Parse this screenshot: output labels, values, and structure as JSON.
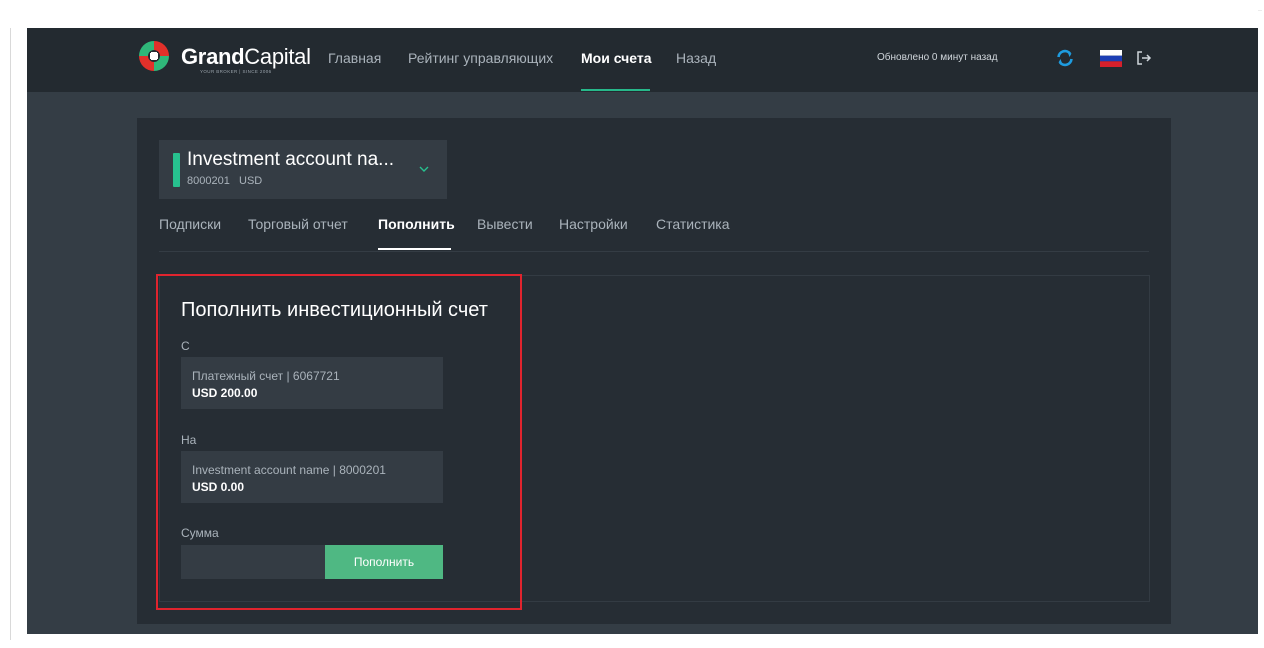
{
  "brand": {
    "name_bold": "Grand",
    "name_light": "Capital",
    "tagline": "YOUR BROKER | SINCE 2006",
    "colors": {
      "red": "#e2302a",
      "green": "#2fb779",
      "white": "#ffffff"
    }
  },
  "nav": {
    "items": [
      {
        "label": "Главная",
        "active": false
      },
      {
        "label": "Рейтинг управляющих",
        "active": false
      },
      {
        "label": "Мои счета",
        "active": true
      },
      {
        "label": "Назад",
        "active": false
      }
    ],
    "updated_text": "Обновлено 0 минут назад",
    "refresh_icon": "refresh-icon",
    "language_icon": "russian-flag-icon",
    "logout_icon": "logout-icon"
  },
  "account_selector": {
    "name": "Investment account na...",
    "number": "8000201",
    "currency": "USD"
  },
  "tabs": [
    {
      "label": "Подписки",
      "active": false
    },
    {
      "label": "Торговый отчет",
      "active": false
    },
    {
      "label": "Пополнить",
      "active": true
    },
    {
      "label": "Вывести",
      "active": false
    },
    {
      "label": "Настройки",
      "active": false
    },
    {
      "label": "Статистика",
      "active": false
    }
  ],
  "deposit_form": {
    "title": "Пополнить инвестиционный счет",
    "from_label": "С",
    "from_account": {
      "line1": "Платежный счет | 6067721",
      "line2": "USD 200.00"
    },
    "to_label": "На",
    "to_account": {
      "line1": "Investment account name | 8000201",
      "line2": "USD 0.00"
    },
    "amount_label": "Сумма",
    "amount_value": "",
    "submit_label": "Пополнить"
  },
  "colors": {
    "accent_green": "#27b88a",
    "button_green": "#4fb883",
    "highlight_red": "#e0242e",
    "navbar_bg": "#232a30",
    "panel_bg": "#262d34"
  }
}
